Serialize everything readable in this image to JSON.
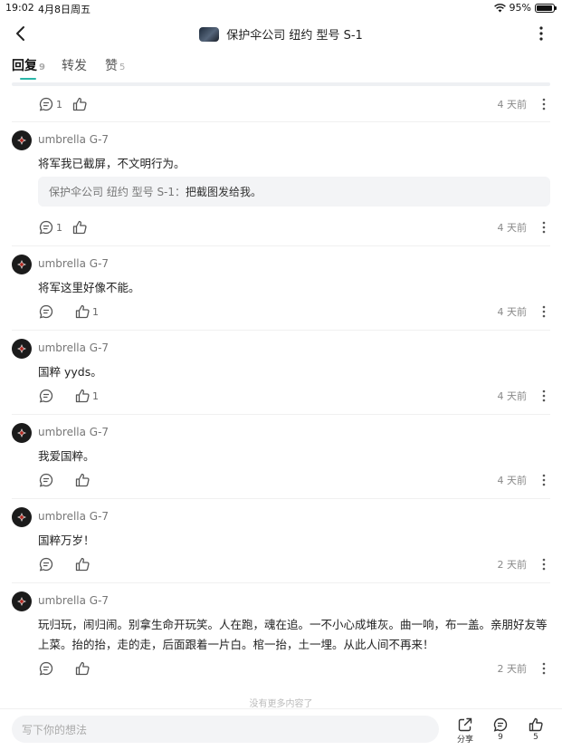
{
  "status": {
    "time": "19:02",
    "date": "4月8日周五",
    "battery": "95%",
    "battery_level": 0.95
  },
  "header": {
    "title": "保护伞公司 纽约 型号 S-1"
  },
  "tabs": [
    {
      "label": "回复",
      "count": "9"
    },
    {
      "label": "转发",
      "count": ""
    },
    {
      "label": "赞",
      "count": "5"
    }
  ],
  "first_row": {
    "comment_count": "1",
    "like_count": "",
    "time": "4 天前"
  },
  "comments": [
    {
      "user": "umbrella  G-7",
      "text": "将军我已截屏，不文明行为。",
      "quote_author": "保护伞公司 纽约 型号 S-1：",
      "quote_text": "把截图发给我。",
      "comment_count": "1",
      "like_count": "",
      "time": "4 天前"
    },
    {
      "user": "umbrella  G-7",
      "text": "将军这里好像不能。",
      "comment_count": "",
      "like_count": "1",
      "time": "4 天前"
    },
    {
      "user": "umbrella  G-7",
      "text": "国粹 yyds。",
      "comment_count": "",
      "like_count": "1",
      "time": "4 天前"
    },
    {
      "user": "umbrella  G-7",
      "text": "我爱国粹。",
      "comment_count": "",
      "like_count": "",
      "time": "4 天前"
    },
    {
      "user": "umbrella  G-7",
      "text": "国粹万岁！",
      "comment_count": "",
      "like_count": "",
      "time": "2 天前"
    },
    {
      "user": "umbrella  G-7",
      "text_line1": "玩归玩，闹归闹。别拿生命开玩笑。人在跑，魂在追。一不小心成堆灰。曲一响，布一盖。亲朋好友等",
      "text_line2": "上菜。抬的抬，走的走，后面跟着一片白。棺一抬，土一埋。从此人间不再来！",
      "comment_count": "",
      "like_count": "",
      "time": "2 天前"
    }
  ],
  "footer": {
    "no_more": "没有更多内容了",
    "input_placeholder": "写下你的想法",
    "share_label": "分享",
    "comment_count": "9",
    "like_count": "5"
  },
  "icons": {
    "back": "chevron-left-icon",
    "more": "more-vertical-icon",
    "comment": "comment-icon",
    "like": "thumbs-up-icon",
    "share": "share-icon",
    "wifi": "wifi-icon",
    "battery": "battery-icon"
  },
  "colors": {
    "accent": "#2ab6a8"
  }
}
